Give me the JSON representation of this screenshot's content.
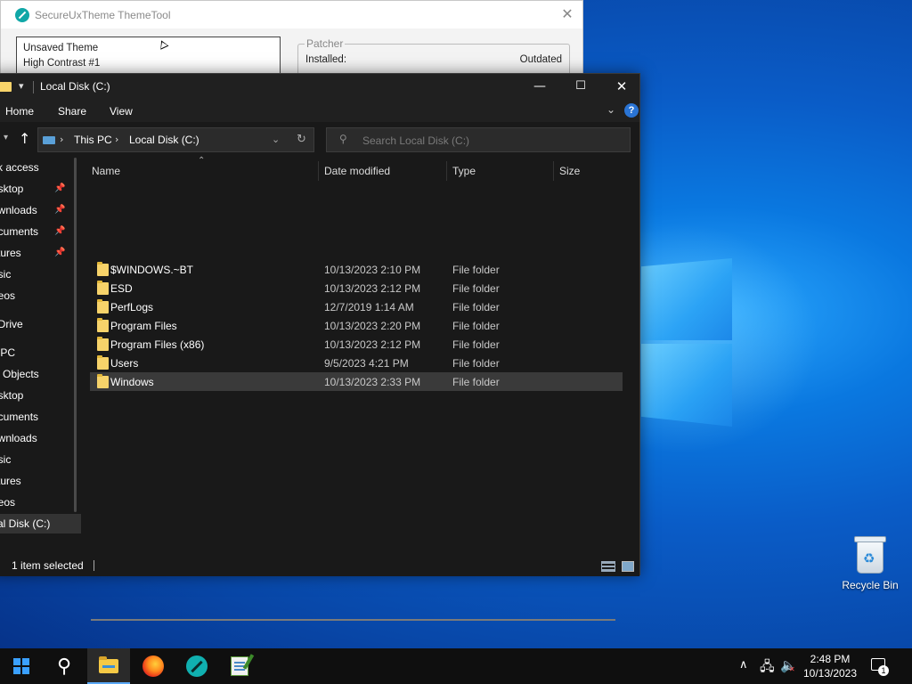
{
  "colors": {
    "desktop_blue": "#0a5cc7",
    "explorer_bg": "#191919",
    "folder_yellow": "#f7d36a",
    "taskbar_bg": "#0f0f0f",
    "accent": "#3aa0ff"
  },
  "themetool": {
    "title": "SecureUxTheme ThemeTool",
    "theme_name": "Unsaved Theme",
    "theme_subtitle": "High Contrast #1",
    "patcher_label": "Patcher",
    "installed_label": "Installed:",
    "installed_status": "Outdated",
    "close_icon": "close-icon"
  },
  "explorer": {
    "title": "Local Disk (C:)",
    "ribbon_tabs": [
      "Home",
      "Share",
      "View"
    ],
    "address": {
      "crumbs": [
        "This PC",
        "Local Disk (C:)"
      ]
    },
    "search_placeholder": "Search Local Disk (C:)",
    "nav_items": [
      {
        "label": "ck access",
        "pinned": false
      },
      {
        "label": "esktop",
        "pinned": true
      },
      {
        "label": "ownloads",
        "pinned": true
      },
      {
        "label": "ocuments",
        "pinned": true
      },
      {
        "label": "ctures",
        "pinned": true
      },
      {
        "label": "usic",
        "pinned": false
      },
      {
        "label": "deos",
        "pinned": false
      },
      {
        "label": "eDrive",
        "pinned": false
      },
      {
        "label": "s PC",
        "pinned": false
      },
      {
        "label": "D Objects",
        "pinned": false
      },
      {
        "label": "esktop",
        "pinned": false
      },
      {
        "label": "ocuments",
        "pinned": false
      },
      {
        "label": "ownloads",
        "pinned": false
      },
      {
        "label": "usic",
        "pinned": false
      },
      {
        "label": "ctures",
        "pinned": false
      },
      {
        "label": "deos",
        "pinned": false
      },
      {
        "label": "cal Disk (C:)",
        "pinned": false,
        "selected": true
      }
    ],
    "columns": [
      "Name",
      "Date modified",
      "Type",
      "Size"
    ],
    "files": [
      {
        "name": "$WINDOWS.~BT",
        "date": "10/13/2023 2:10 PM",
        "type": "File folder"
      },
      {
        "name": "ESD",
        "date": "10/13/2023 2:12 PM",
        "type": "File folder"
      },
      {
        "name": "PerfLogs",
        "date": "12/7/2019 1:14 AM",
        "type": "File folder"
      },
      {
        "name": "Program Files",
        "date": "10/13/2023 2:20 PM",
        "type": "File folder"
      },
      {
        "name": "Program Files (x86)",
        "date": "10/13/2023 2:12 PM",
        "type": "File folder"
      },
      {
        "name": "Users",
        "date": "9/5/2023 4:21 PM",
        "type": "File folder"
      },
      {
        "name": "Windows",
        "date": "10/13/2023 2:33 PM",
        "type": "File folder",
        "selected": true
      }
    ],
    "status_text": "1 item selected"
  },
  "desktop": {
    "recycle_bin_label": "Recycle Bin"
  },
  "taskbar": {
    "apps": [
      "start-icon",
      "search-icon",
      "file-explorer-icon",
      "firefox-icon",
      "securextheme-icon",
      "notepad-plus-icon"
    ],
    "active_app": "file-explorer-icon",
    "time": "2:48 PM",
    "date": "10/13/2023",
    "notification_count": "1"
  }
}
